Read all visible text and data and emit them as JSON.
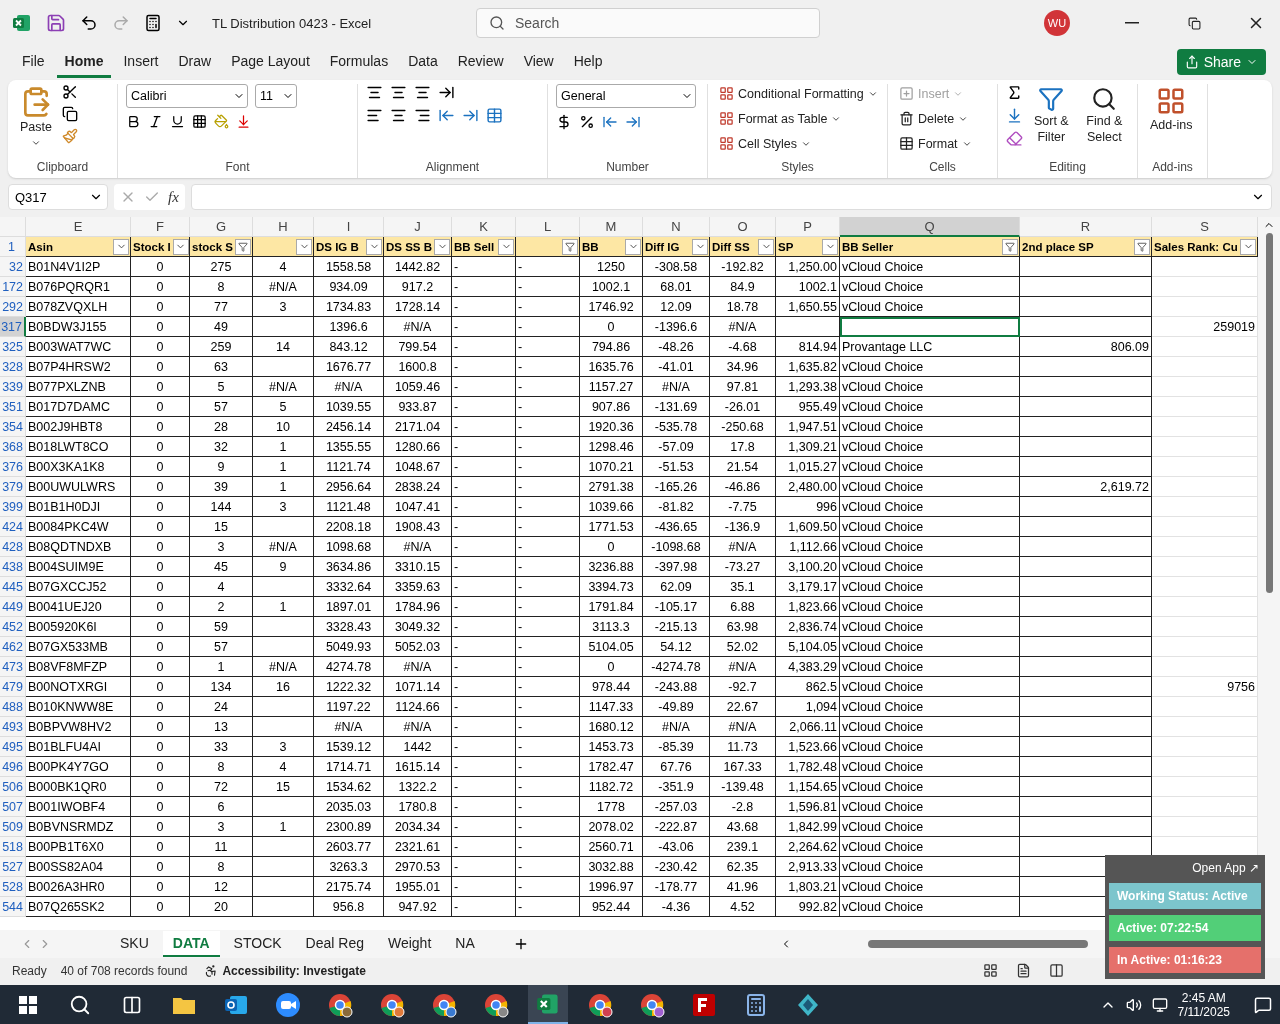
{
  "title_bar": {
    "document": "TL Distribution 0423  -  Excel",
    "search_placeholder": "Search",
    "avatar": "WU"
  },
  "menu_tabs": [
    {
      "label": "File",
      "selected": false
    },
    {
      "label": "Home",
      "selected": true
    },
    {
      "label": "Insert",
      "selected": false
    },
    {
      "label": "Draw",
      "selected": false
    },
    {
      "label": "Page Layout",
      "selected": false
    },
    {
      "label": "Formulas",
      "selected": false
    },
    {
      "label": "Data",
      "selected": false
    },
    {
      "label": "Review",
      "selected": false
    },
    {
      "label": "View",
      "selected": false
    },
    {
      "label": "Help",
      "selected": false
    }
  ],
  "share": "Share",
  "ribbon": {
    "clipboard": {
      "label": "Clipboard",
      "paste": "Paste"
    },
    "font": {
      "label": "Font",
      "font_name": "Calibri",
      "font_size": "11"
    },
    "alignment": {
      "label": "Alignment"
    },
    "number": {
      "label": "Number",
      "format": "General"
    },
    "styles": {
      "label": "Styles",
      "items": [
        "Conditional Formatting",
        "Format as Table",
        "Cell Styles"
      ]
    },
    "cells": {
      "label": "Cells",
      "items": [
        {
          "label": "Insert",
          "disabled": true
        },
        {
          "label": "Delete",
          "disabled": false
        },
        {
          "label": "Format",
          "disabled": false
        }
      ]
    },
    "editing": {
      "label": "Editing",
      "items": [
        "Sort & Filter",
        "Find & Select"
      ]
    },
    "addins": {
      "label": "Add-ins",
      "button": "Add-ins"
    }
  },
  "formula_bar": {
    "name_box": "Q317",
    "fx": "fx"
  },
  "columns": [
    {
      "letter": "E",
      "header": "Asin",
      "filtered": false,
      "selected": false
    },
    {
      "letter": "F",
      "header": "Stock I",
      "filtered": false,
      "selected": false
    },
    {
      "letter": "G",
      "header": "stock S",
      "filtered": true,
      "selected": false
    },
    {
      "letter": "H",
      "filtered": false,
      "selected": false
    },
    {
      "letter": "I",
      "header": "DS IG B",
      "filtered": false,
      "selected": false
    },
    {
      "letter": "J",
      "header": "DS SS B",
      "filtered": false,
      "selected": false
    },
    {
      "letter": "K",
      "header": "BB Sell",
      "filtered": false,
      "selected": false
    },
    {
      "letter": "L",
      "filtered": true,
      "selected": false
    },
    {
      "letter": "M",
      "header": "BB",
      "filtered": false,
      "selected": false
    },
    {
      "letter": "N",
      "header": "Diff IG",
      "filtered": false,
      "selected": false
    },
    {
      "letter": "O",
      "header": "Diff SS",
      "filtered": false,
      "selected": false
    },
    {
      "letter": "P",
      "header": "SP",
      "filtered": false,
      "selected": false
    },
    {
      "letter": "Q",
      "header": "BB Seller",
      "filtered": true,
      "selected": true
    },
    {
      "letter": "R",
      "header": "2nd place SP",
      "filtered": true,
      "selected": false
    },
    {
      "letter": "S",
      "header": "Sales Rank: Cu",
      "filtered": false,
      "selected": false
    }
  ],
  "header_row": "1",
  "rows": [
    {
      "num": "32",
      "selected": false,
      "cells": [
        "B01N4V1I2P",
        "0",
        "275",
        "4",
        "1558.58",
        "1442.82",
        "-",
        "-",
        "1250",
        "-308.58",
        "-192.82",
        "1,250.00",
        "vCloud Choice",
        null,
        null
      ]
    },
    {
      "num": "172",
      "selected": false,
      "cells": [
        "B076PQRQR1",
        "0",
        "8",
        "#N/A",
        "934.09",
        "917.2",
        "-",
        "-",
        "1002.1",
        "68.01",
        "84.9",
        "1002.1",
        "vCloud Choice",
        null,
        null
      ]
    },
    {
      "num": "292",
      "selected": false,
      "cells": [
        "B078ZVQXLH",
        "0",
        "77",
        "3",
        "1734.83",
        "1728.14",
        "-",
        "-",
        "1746.92",
        "12.09",
        "18.78",
        "1,650.55",
        "vCloud Choice",
        null,
        null
      ]
    },
    {
      "num": "317",
      "selected": true,
      "cells": [
        "B0BDW3J155",
        "0",
        "49",
        null,
        "1396.6",
        "#N/A",
        "-",
        "-",
        "0",
        "-1396.6",
        "#N/A",
        null,
        null,
        null,
        "259019"
      ]
    },
    {
      "num": "325",
      "selected": false,
      "cells": [
        "B003WAT7WC",
        "0",
        "259",
        "14",
        "843.12",
        "799.54",
        "-",
        "-",
        "794.86",
        "-48.26",
        "-4.68",
        "814.94",
        "Provantage LLC",
        "806.09",
        null
      ]
    },
    {
      "num": "328",
      "selected": false,
      "cells": [
        "B07P4HRSW2",
        "0",
        "63",
        null,
        "1676.77",
        "1600.8",
        "-",
        "-",
        "1635.76",
        "-41.01",
        "34.96",
        "1,635.82",
        "vCloud Choice",
        null,
        null
      ]
    },
    {
      "num": "339",
      "selected": false,
      "cells": [
        "B077PXLZNB",
        "0",
        "5",
        "#N/A",
        "#N/A",
        "1059.46",
        "-",
        "-",
        "1157.27",
        "#N/A",
        "97.81",
        "1,293.38",
        "vCloud Choice",
        null,
        null
      ]
    },
    {
      "num": "351",
      "selected": false,
      "cells": [
        "B017D7DAMC",
        "0",
        "57",
        "5",
        "1039.55",
        "933.87",
        "-",
        "-",
        "907.86",
        "-131.69",
        "-26.01",
        "955.49",
        "vCloud Choice",
        null,
        null
      ]
    },
    {
      "num": "354",
      "selected": false,
      "cells": [
        "B002J9HBT8",
        "0",
        "28",
        "10",
        "2456.14",
        "2171.04",
        "-",
        "-",
        "1920.36",
        "-535.78",
        "-250.68",
        "1,947.51",
        "vCloud Choice",
        null,
        null
      ]
    },
    {
      "num": "368",
      "selected": false,
      "cells": [
        "B018LWT8CO",
        "0",
        "32",
        "1",
        "1355.55",
        "1280.66",
        "-",
        "-",
        "1298.46",
        "-57.09",
        "17.8",
        "1,309.21",
        "vCloud Choice",
        null,
        null
      ]
    },
    {
      "num": "376",
      "selected": false,
      "cells": [
        "B00X3KA1K8",
        "0",
        "9",
        "1",
        "1121.74",
        "1048.67",
        "-",
        "-",
        "1070.21",
        "-51.53",
        "21.54",
        "1,015.27",
        "vCloud Choice",
        null,
        null
      ]
    },
    {
      "num": "379",
      "selected": false,
      "cells": [
        "B00UWULWRS",
        "0",
        "39",
        "1",
        "2956.64",
        "2838.24",
        "-",
        "-",
        "2791.38",
        "-165.26",
        "-46.86",
        "2,480.00",
        "vCloud Choice",
        "2,619.72",
        null
      ]
    },
    {
      "num": "399",
      "selected": false,
      "cells": [
        "B01B1H0DJI",
        "0",
        "144",
        "3",
        "1121.48",
        "1047.41",
        "-",
        "-",
        "1039.66",
        "-81.82",
        "-7.75",
        "996",
        "vCloud Choice",
        null,
        null
      ]
    },
    {
      "num": "424",
      "selected": false,
      "cells": [
        "B0084PKC4W",
        "0",
        "15",
        null,
        "2208.18",
        "1908.43",
        "-",
        "-",
        "1771.53",
        "-436.65",
        "-136.9",
        "1,609.50",
        "vCloud Choice",
        null,
        null
      ]
    },
    {
      "num": "428",
      "selected": false,
      "cells": [
        "B08QDTNDXB",
        "0",
        "3",
        "#N/A",
        "1098.68",
        "#N/A",
        "-",
        "-",
        "0",
        "-1098.68",
        "#N/A",
        "1,112.66",
        "vCloud Choice",
        null,
        null
      ]
    },
    {
      "num": "438",
      "selected": false,
      "cells": [
        "B004SUIM9E",
        "0",
        "45",
        "9",
        "3634.86",
        "3310.15",
        "-",
        "-",
        "3236.88",
        "-397.98",
        "-73.27",
        "3,100.20",
        "vCloud Choice",
        null,
        null
      ]
    },
    {
      "num": "445",
      "selected": false,
      "cells": [
        "B07GXCCJ52",
        "0",
        "4",
        null,
        "3332.64",
        "3359.63",
        "-",
        "-",
        "3394.73",
        "62.09",
        "35.1",
        "3,179.17",
        "vCloud Choice",
        null,
        null
      ]
    },
    {
      "num": "449",
      "selected": false,
      "cells": [
        "B0041UEJ20",
        "0",
        "2",
        "1",
        "1897.01",
        "1784.96",
        "-",
        "-",
        "1791.84",
        "-105.17",
        "6.88",
        "1,823.66",
        "vCloud Choice",
        null,
        null
      ]
    },
    {
      "num": "452",
      "selected": false,
      "cells": [
        "B005920K6I",
        "0",
        "59",
        null,
        "3328.43",
        "3049.32",
        "-",
        "-",
        "3113.3",
        "-215.13",
        "63.98",
        "2,836.74",
        "vCloud Choice",
        null,
        null
      ]
    },
    {
      "num": "462",
      "selected": false,
      "cells": [
        "B07GX533MB",
        "0",
        "57",
        null,
        "5049.93",
        "5052.03",
        "-",
        "-",
        "5104.05",
        "54.12",
        "52.02",
        "5,104.05",
        "vCloud Choice",
        null,
        null
      ]
    },
    {
      "num": "473",
      "selected": false,
      "cells": [
        "B08VF8MFZP",
        "0",
        "1",
        "#N/A",
        "4274.78",
        "#N/A",
        "-",
        "-",
        "0",
        "-4274.78",
        "#N/A",
        "4,383.29",
        "vCloud Choice",
        null,
        null
      ]
    },
    {
      "num": "479",
      "selected": false,
      "cells": [
        "B00NOTXRGI",
        "0",
        "134",
        "16",
        "1222.32",
        "1071.14",
        "-",
        "-",
        "978.44",
        "-243.88",
        "-92.7",
        "862.5",
        "vCloud Choice",
        null,
        "9756"
      ]
    },
    {
      "num": "488",
      "selected": false,
      "cells": [
        "B010KNWW8E",
        "0",
        "24",
        null,
        "1197.22",
        "1124.66",
        "-",
        "-",
        "1147.33",
        "-49.89",
        "22.67",
        "1,094",
        "vCloud Choice",
        null,
        null
      ]
    },
    {
      "num": "493",
      "selected": false,
      "cells": [
        "B0BPVW8HV2",
        "0",
        "13",
        null,
        "#N/A",
        "#N/A",
        "-",
        "-",
        "1680.12",
        "#N/A",
        "#N/A",
        "2,066.11",
        "vCloud Choice",
        null,
        null
      ]
    },
    {
      "num": "495",
      "selected": false,
      "cells": [
        "B01BLFU4AI",
        "0",
        "33",
        "3",
        "1539.12",
        "1442",
        "-",
        "-",
        "1453.73",
        "-85.39",
        "11.73",
        "1,523.66",
        "vCloud Choice",
        null,
        null
      ]
    },
    {
      "num": "496",
      "selected": false,
      "cells": [
        "B00PK4Y7GO",
        "0",
        "8",
        "4",
        "1714.71",
        "1615.14",
        "-",
        "-",
        "1782.47",
        "67.76",
        "167.33",
        "1,782.48",
        "vCloud Choice",
        null,
        null
      ]
    },
    {
      "num": "506",
      "selected": false,
      "cells": [
        "B000BK1QR0",
        "0",
        "72",
        "15",
        "1534.62",
        "1322.2",
        "-",
        "-",
        "1182.72",
        "-351.9",
        "-139.48",
        "1,154.65",
        "vCloud Choice",
        null,
        null
      ]
    },
    {
      "num": "507",
      "selected": false,
      "cells": [
        "B001IWOBF4",
        "0",
        "6",
        null,
        "2035.03",
        "1780.8",
        "-",
        "-",
        "1778",
        "-257.03",
        "-2.8",
        "1,596.81",
        "vCloud Choice",
        null,
        null
      ]
    },
    {
      "num": "509",
      "selected": false,
      "cells": [
        "B0BVNSRMDZ",
        "0",
        "3",
        "1",
        "2300.89",
        "2034.34",
        "-",
        "-",
        "2078.02",
        "-222.87",
        "43.68",
        "1,842.99",
        "vCloud Choice",
        null,
        null
      ]
    },
    {
      "num": "518",
      "selected": false,
      "cells": [
        "B00PB1T6X0",
        "0",
        "11",
        null,
        "2603.77",
        "2321.61",
        "-",
        "-",
        "2560.71",
        "-43.06",
        "239.1",
        "2,264.62",
        "vCloud Choice",
        null,
        null
      ]
    },
    {
      "num": "527",
      "selected": false,
      "cells": [
        "B00SS82A04",
        "0",
        "8",
        null,
        "3263.3",
        "2970.53",
        "-",
        "-",
        "3032.88",
        "-230.42",
        "62.35",
        "2,913.33",
        "vCloud Choice",
        null,
        null
      ]
    },
    {
      "num": "528",
      "selected": false,
      "cells": [
        "B0026A3HR0",
        "0",
        "12",
        null,
        "2175.74",
        "1955.01",
        "-",
        "-",
        "1996.97",
        "-178.77",
        "41.96",
        "1,803.21",
        "vCloud Choice",
        null,
        null
      ]
    },
    {
      "num": "544",
      "selected": false,
      "cells": [
        "B07Q265SK2",
        "0",
        "20",
        null,
        "956.8",
        "947.92",
        "-",
        "-",
        "952.44",
        "-4.36",
        "4.52",
        "992.82",
        "vCloud Choice",
        null,
        null
      ]
    }
  ],
  "sheet_tabs": [
    {
      "label": "SKU",
      "selected": false
    },
    {
      "label": "DATA",
      "selected": true
    },
    {
      "label": "STOCK",
      "selected": false
    },
    {
      "label": "Deal Reg",
      "selected": false
    },
    {
      "label": "Weight",
      "selected": false
    },
    {
      "label": "NA",
      "selected": false
    }
  ],
  "status_bar": {
    "mode": "Ready",
    "records": "40 of 708 records found",
    "accessibility": "Accessibility: Investigate"
  },
  "tracker": {
    "open_app": "Open App ↗",
    "status": "Working Status: Active",
    "active": "Active: 07:22:54",
    "inactive": "In Active: 01:16:23"
  },
  "taskbar": {
    "time": "2:45 AM",
    "date": "7/11/2025"
  }
}
